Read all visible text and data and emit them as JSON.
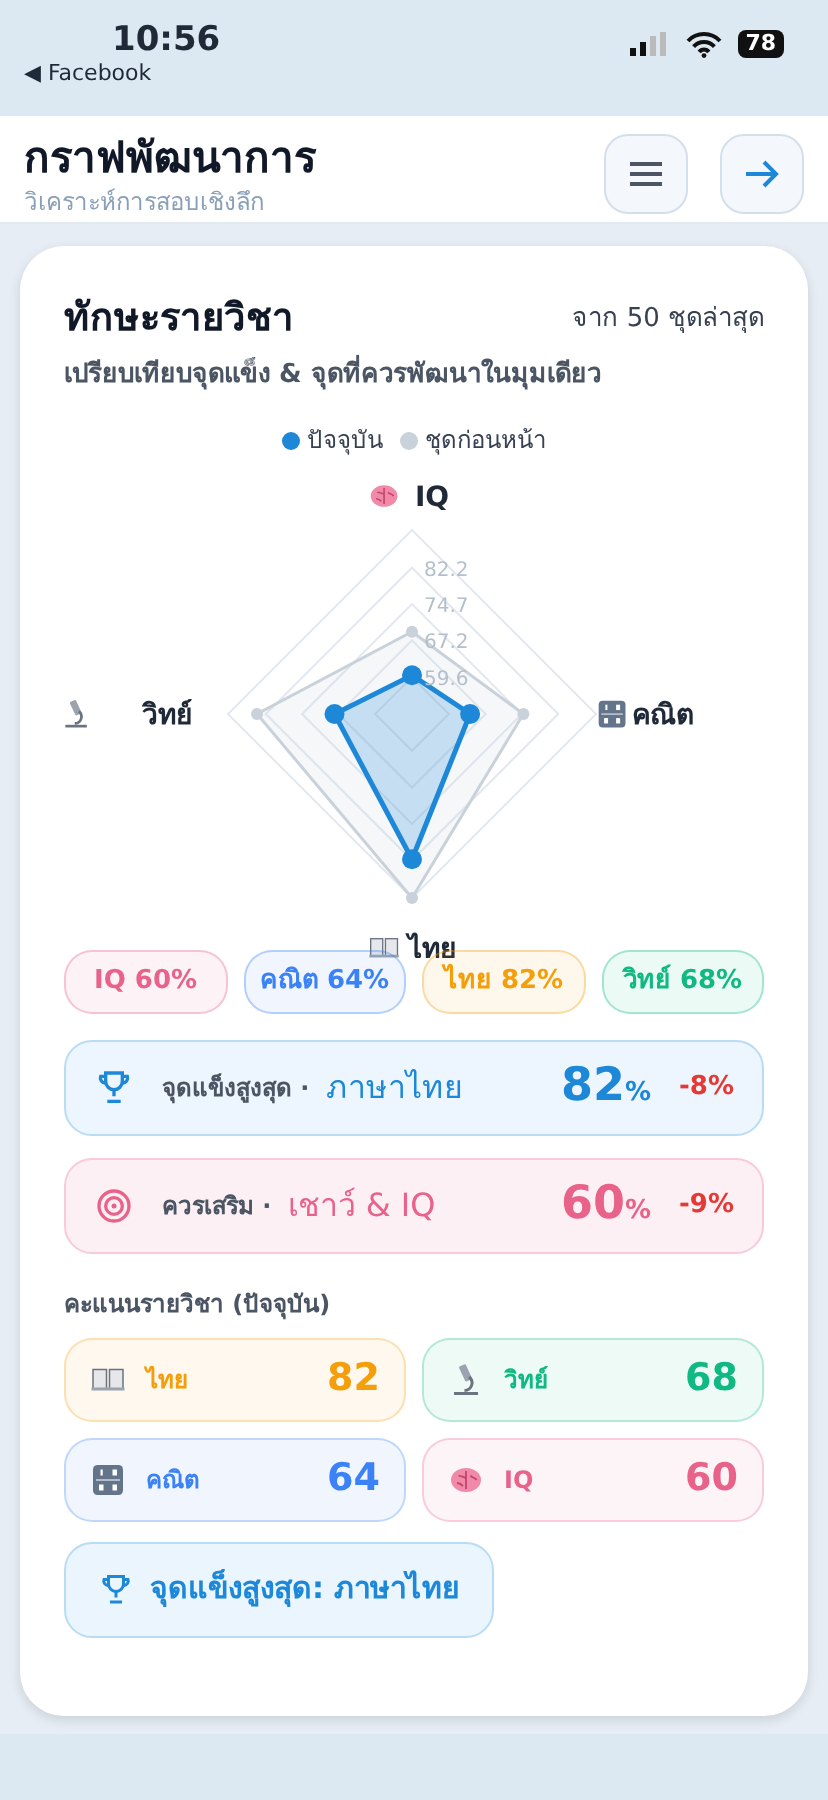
{
  "status_bar": {
    "time": "10:56",
    "back_app": "◀ Facebook",
    "battery": "78"
  },
  "header": {
    "title": "กราฟพัฒนาการ",
    "subtitle": "วิเคราะห์การสอบเชิงลึก"
  },
  "card": {
    "title": "ทักษะรายวิชา",
    "note": "จาก 50 ชุดล่าสุด",
    "description": "เปรียบเทียบจุดแข็ง & จุดที่ควรพัฒนาในมุมเดียว",
    "chart_data": {
      "type": "radar",
      "categories": [
        "IQ",
        "คณิต",
        "ไทย",
        "วิทย์"
      ],
      "series": [
        {
          "name": "ปัจจุบัน",
          "color": "#1e88d8",
          "values": [
            60,
            64,
            82,
            68
          ]
        },
        {
          "name": "ชุดก่อนหน้า",
          "color": "#c9d1db",
          "values": [
            69,
            75,
            90,
            84
          ]
        }
      ],
      "ylim": [
        52,
        90
      ],
      "yticks": [
        59.6,
        67.2,
        74.7,
        82.2
      ]
    },
    "chips": [
      {
        "label": "IQ 60%",
        "color": "#e8628a"
      },
      {
        "label": "คณิต 64%",
        "color": "#3b82f6"
      },
      {
        "label": "ไทย 82%",
        "color": "#f59e0b"
      },
      {
        "label": "วิทย์ 68%",
        "color": "#10b981"
      }
    ],
    "highlights": [
      {
        "kind": "strength",
        "label": "จุดแข็งสูงสุด ·",
        "subject": "ภาษาไทย",
        "value": "82",
        "unit": "%",
        "change": "-8%"
      },
      {
        "kind": "weakness",
        "label": "ควรเสริม ·",
        "subject": "เชาว์ & IQ",
        "value": "60",
        "unit": "%",
        "change": "-9%"
      }
    ],
    "scores_title": "คะแนนรายวิชา (ปัจจุบัน)",
    "scores": [
      {
        "kind": "book",
        "subject": "ไทย",
        "score": "82",
        "color": "#f59e0b"
      },
      {
        "kind": "microscope",
        "subject": "วิทย์",
        "score": "68",
        "color": "#10b981"
      },
      {
        "kind": "numbers",
        "subject": "คณิต",
        "score": "64",
        "color": "#3b82f6"
      },
      {
        "kind": "brain",
        "subject": "IQ",
        "score": "60",
        "color": "#e8628a"
      }
    ],
    "action_button": "จุดแข็งสูงสุด: ภาษาไทย"
  }
}
